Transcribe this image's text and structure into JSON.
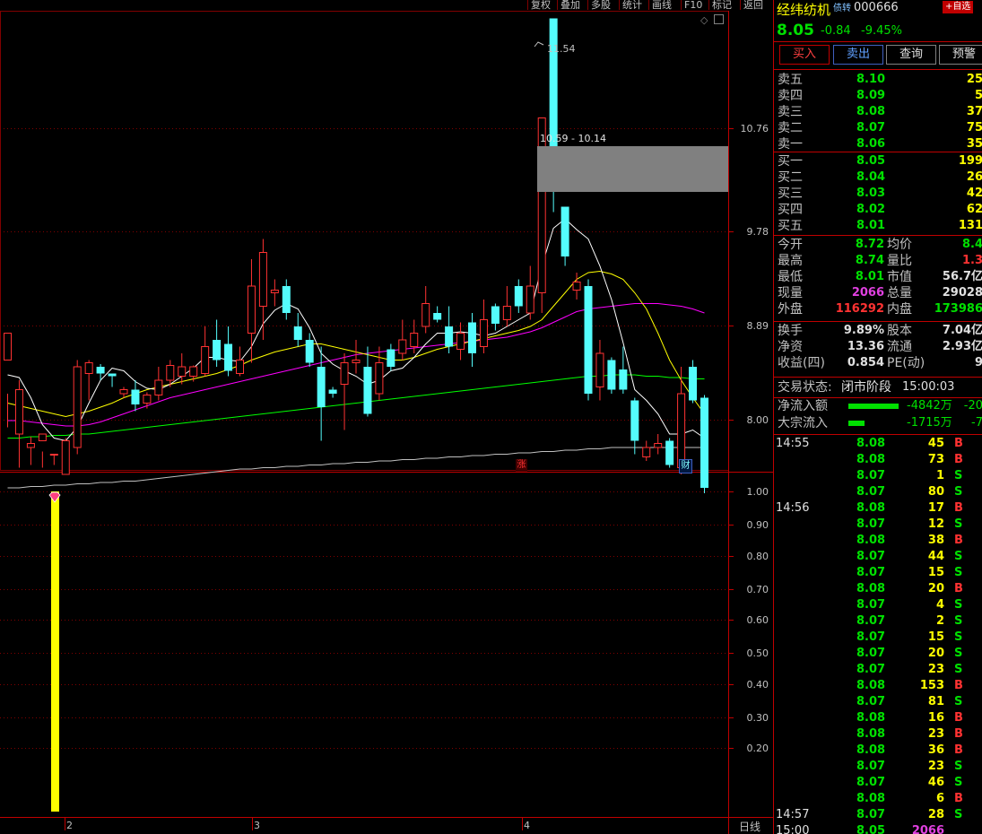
{
  "toolbar": {
    "buttons": [
      "复权",
      "叠加",
      "多股",
      "统计",
      "画线",
      "F10",
      "标记",
      "返回"
    ]
  },
  "chart": {
    "price_axis": [
      "10.76",
      "9.78",
      "8.89",
      "8.00"
    ],
    "peak_label": "11.54",
    "range_label": "10.59 - 10.14",
    "zhang_label": "涨",
    "cai_label": "财",
    "sub_axis": [
      "1.00",
      "0.90",
      "0.80",
      "0.70",
      "0.60",
      "0.50",
      "0.40",
      "0.30",
      "0.20"
    ],
    "date_labels": [
      "2",
      "3",
      "4"
    ],
    "period_label": "日线"
  },
  "chart_data": {
    "type": "candlestick",
    "ohlc": [
      [
        9.0,
        9.2,
        8.75,
        8.5
      ],
      [
        8.45,
        8.78,
        8.85,
        8.2
      ],
      [
        8.35,
        8.38,
        8.43,
        8.22
      ],
      [
        8.4,
        8.45,
        8.32,
        8.2
      ],
      [
        8.3,
        8.3,
        8.3,
        8.22
      ],
      [
        8.15,
        8.4,
        8.42,
        8.15
      ],
      [
        8.35,
        8.95,
        9.0,
        8.3
      ],
      [
        8.9,
        8.98,
        9.0,
        8.7
      ],
      [
        8.95,
        8.9,
        8.97,
        8.85
      ],
      [
        8.9,
        8.88,
        8.9,
        8.8
      ],
      [
        8.75,
        8.78,
        8.8,
        8.72
      ],
      [
        8.78,
        8.67,
        8.85,
        8.62
      ],
      [
        8.68,
        8.74,
        8.76,
        8.64
      ],
      [
        8.74,
        8.85,
        8.95,
        8.7
      ],
      [
        8.85,
        8.96,
        9.0,
        8.8
      ],
      [
        8.88,
        8.95,
        9.05,
        8.82
      ],
      [
        8.88,
        8.95,
        8.96,
        8.84
      ],
      [
        8.9,
        9.1,
        9.25,
        8.88
      ],
      [
        9.15,
        9.0,
        9.3,
        8.95
      ],
      [
        9.12,
        8.92,
        9.25,
        8.88
      ],
      [
        8.9,
        9.0,
        9.1,
        8.88
      ],
      [
        9.2,
        9.55,
        9.75,
        8.98
      ],
      [
        9.4,
        9.8,
        9.9,
        9.15
      ],
      [
        9.5,
        9.52,
        9.6,
        9.4
      ],
      [
        9.55,
        9.35,
        9.6,
        9.3
      ],
      [
        9.25,
        9.15,
        9.35,
        9.1
      ],
      [
        9.15,
        8.98,
        9.2,
        8.95
      ],
      [
        8.95,
        8.65,
        9.1,
        8.4
      ],
      [
        8.78,
        8.75,
        8.8,
        8.72
      ],
      [
        8.82,
        8.98,
        9.05,
        8.48
      ],
      [
        8.98,
        9.0,
        9.15,
        8.9
      ],
      [
        8.95,
        8.6,
        9.1,
        8.58
      ],
      [
        8.75,
        8.98,
        9.1,
        8.7
      ],
      [
        9.08,
        8.95,
        9.12,
        8.92
      ],
      [
        9.05,
        9.15,
        9.3,
        9.0
      ],
      [
        9.1,
        9.2,
        9.3,
        9.05
      ],
      [
        9.25,
        9.42,
        9.55,
        9.2
      ],
      [
        9.35,
        9.3,
        9.4,
        9.28
      ],
      [
        9.25,
        9.1,
        9.4,
        9.05
      ],
      [
        9.08,
        9.2,
        9.28,
        9.0
      ],
      [
        9.28,
        9.05,
        9.35,
        8.95
      ],
      [
        9.1,
        9.3,
        9.45,
        9.05
      ],
      [
        9.4,
        9.27,
        9.42,
        9.22
      ],
      [
        9.3,
        9.4,
        9.55,
        9.25
      ],
      [
        9.55,
        9.4,
        9.6,
        9.35
      ],
      [
        9.35,
        9.55,
        9.7,
        9.3
      ],
      [
        9.5,
        10.8,
        10.8,
        9.35
      ],
      [
        11.54,
        10.59,
        11.54,
        10.1
      ],
      [
        10.14,
        9.77,
        10.14,
        9.7
      ],
      [
        9.52,
        9.58,
        9.65,
        9.45
      ],
      [
        9.55,
        8.75,
        9.6,
        8.7
      ],
      [
        8.8,
        9.05,
        9.15,
        8.7
      ],
      [
        9.0,
        8.78,
        9.02,
        8.75
      ],
      [
        8.93,
        8.78,
        9.1,
        8.75
      ],
      [
        8.7,
        8.4,
        8.72,
        8.3
      ],
      [
        8.28,
        8.35,
        8.4,
        8.25
      ],
      [
        8.35,
        8.38,
        8.45,
        8.3
      ],
      [
        8.4,
        8.22,
        8.42,
        8.2
      ],
      [
        8.2,
        8.75,
        8.95,
        8.15
      ],
      [
        8.95,
        8.7,
        9.0,
        8.68
      ],
      [
        8.72,
        8.05,
        8.74,
        8.01
      ]
    ],
    "ma5": [
      8.89,
      8.87,
      8.72,
      8.52,
      8.42,
      8.4,
      8.5,
      8.68,
      8.85,
      8.94,
      8.92,
      8.84,
      8.79,
      8.78,
      8.82,
      8.88,
      8.94,
      9.02,
      9.02,
      9.0,
      8.99,
      9.1,
      9.27,
      9.37,
      9.42,
      9.38,
      9.24,
      9.05,
      8.97,
      8.92,
      8.88,
      8.82,
      8.85,
      8.92,
      8.94,
      9.02,
      9.12,
      9.2,
      9.2,
      9.21,
      9.2,
      9.18,
      9.2,
      9.25,
      9.3,
      9.35,
      9.7,
      9.98,
      10.05,
      9.97,
      9.9,
      9.7,
      9.45,
      9.13,
      8.78,
      8.7,
      8.6,
      8.45,
      8.45,
      8.48,
      8.42
    ],
    "ma10": [
      8.68,
      8.66,
      8.64,
      8.62,
      8.6,
      8.58,
      8.6,
      8.62,
      8.65,
      8.68,
      8.72,
      8.75,
      8.78,
      8.8,
      8.82,
      8.84,
      8.86,
      8.88,
      8.9,
      8.93,
      8.96,
      9.0,
      9.03,
      9.06,
      9.08,
      9.1,
      9.12,
      9.12,
      9.1,
      9.08,
      9.06,
      9.04,
      9.02,
      9.0,
      9.0,
      9.02,
      9.05,
      9.08,
      9.1,
      9.12,
      9.14,
      9.16,
      9.18,
      9.2,
      9.22,
      9.25,
      9.3,
      9.4,
      9.5,
      9.6,
      9.65,
      9.66,
      9.64,
      9.6,
      9.5,
      9.38,
      9.2,
      9.0,
      8.85,
      8.72,
      8.6
    ],
    "ma20": [
      8.55,
      8.55,
      8.54,
      8.53,
      8.52,
      8.51,
      8.51,
      8.52,
      8.54,
      8.57,
      8.6,
      8.63,
      8.66,
      8.69,
      8.72,
      8.74,
      8.76,
      8.78,
      8.8,
      8.82,
      8.84,
      8.86,
      8.88,
      8.9,
      8.92,
      8.94,
      8.96,
      8.98,
      9.0,
      9.02,
      9.04,
      9.05,
      9.06,
      9.07,
      9.08,
      9.09,
      9.1,
      9.11,
      9.12,
      9.13,
      9.14,
      9.15,
      9.16,
      9.17,
      9.19,
      9.21,
      9.24,
      9.28,
      9.32,
      9.36,
      9.38,
      9.39,
      9.4,
      9.41,
      9.42,
      9.42,
      9.42,
      9.41,
      9.4,
      9.38,
      9.35
    ],
    "ma60": [
      8.42,
      8.42,
      8.43,
      8.43,
      8.44,
      8.44,
      8.45,
      8.45,
      8.46,
      8.47,
      8.48,
      8.49,
      8.5,
      8.51,
      8.52,
      8.53,
      8.54,
      8.55,
      8.56,
      8.57,
      8.58,
      8.59,
      8.6,
      8.61,
      8.62,
      8.63,
      8.64,
      8.65,
      8.66,
      8.67,
      8.68,
      8.69,
      8.7,
      8.71,
      8.72,
      8.73,
      8.74,
      8.75,
      8.76,
      8.77,
      8.78,
      8.79,
      8.8,
      8.81,
      8.82,
      8.83,
      8.84,
      8.85,
      8.86,
      8.87,
      8.88,
      8.88,
      8.89,
      8.89,
      8.89,
      8.88,
      8.88,
      8.87,
      8.87,
      8.86,
      8.86
    ],
    "ma120": [
      8.05,
      8.05,
      8.06,
      8.06,
      8.07,
      8.07,
      8.08,
      8.08,
      8.09,
      8.09,
      8.1,
      8.1,
      8.11,
      8.12,
      8.13,
      8.14,
      8.15,
      8.16,
      8.17,
      8.18,
      8.19,
      8.19,
      8.2,
      8.2,
      8.21,
      8.21,
      8.22,
      8.22,
      8.23,
      8.23,
      8.24,
      8.24,
      8.25,
      8.25,
      8.26,
      8.26,
      8.27,
      8.27,
      8.28,
      8.28,
      8.29,
      8.29,
      8.3,
      8.3,
      8.31,
      8.31,
      8.32,
      8.32,
      8.33,
      8.33,
      8.34,
      8.34,
      8.35,
      8.35,
      8.35,
      8.35,
      8.35,
      8.35,
      8.35,
      8.35,
      8.35
    ],
    "ylim": [
      7.9,
      11.7
    ],
    "indicator": {
      "bar_index": 4,
      "value": 1.0,
      "ylim": [
        0,
        1.0
      ],
      "color": "#ffff00"
    },
    "colors": {
      "up": "#ff3232",
      "down": "#54fcfc",
      "ma5": "#ffffff",
      "ma10": "#ffff00",
      "ma20": "#ff00ff",
      "ma60": "#00ff00",
      "ma120": "#c0c0c0"
    }
  },
  "stock": {
    "name": "经纬纺机",
    "tag": "债转",
    "code": "000666",
    "add_btn": "+自选",
    "price": "8.05",
    "change": "-0.84",
    "change_pct": "-9.45%"
  },
  "actions": [
    "买入",
    "卖出",
    "查询",
    "预警"
  ],
  "asks": [
    {
      "label": "卖五",
      "price": "8.10",
      "vol": "25"
    },
    {
      "label": "卖四",
      "price": "8.09",
      "vol": "5"
    },
    {
      "label": "卖三",
      "price": "8.08",
      "vol": "37"
    },
    {
      "label": "卖二",
      "price": "8.07",
      "vol": "75"
    },
    {
      "label": "卖一",
      "price": "8.06",
      "vol": "35"
    }
  ],
  "bids": [
    {
      "label": "买一",
      "price": "8.05",
      "vol": "199"
    },
    {
      "label": "买二",
      "price": "8.04",
      "vol": "26"
    },
    {
      "label": "买三",
      "price": "8.03",
      "vol": "42"
    },
    {
      "label": "买四",
      "price": "8.02",
      "vol": "62"
    },
    {
      "label": "买五",
      "price": "8.01",
      "vol": "131"
    }
  ],
  "stats": [
    {
      "l1": "今开",
      "v1": "8.72",
      "l2": "均价",
      "v2": "8.4"
    },
    {
      "l1": "最高",
      "v1": "8.74",
      "l2": "量比",
      "v2": "1.3"
    },
    {
      "l1": "最低",
      "v1": "8.01",
      "l2": "市值",
      "v2": "56.7亿"
    },
    {
      "l1": "现量",
      "v1": "2066",
      "l2": "总量",
      "v2": "29028"
    },
    {
      "l1": "外盘",
      "v1": "116292",
      "l2": "内盘",
      "v2": "173986"
    }
  ],
  "stats2": [
    {
      "l1": "换手",
      "v1": "9.89%",
      "l2": "股本",
      "v2": "7.04亿"
    },
    {
      "l1": "净资",
      "v1": "13.36",
      "l2": "流通",
      "v2": "2.93亿"
    },
    {
      "l1": "收益(四)",
      "v1": "0.854",
      "l2": "PE(动)",
      "v2": "9"
    }
  ],
  "trade_state": {
    "label": "交易状态:",
    "state": "闭市阶段",
    "time": "15:00:03"
  },
  "flows": [
    {
      "label": "净流入额",
      "value": "-4842万",
      "extra": "-20"
    },
    {
      "label": "大宗流入",
      "value": "-1715万",
      "extra": "-7"
    }
  ],
  "ticks": [
    {
      "time": "14:55",
      "price": "8.08",
      "vol": "45",
      "bs": "B"
    },
    {
      "time": "",
      "price": "8.08",
      "vol": "73",
      "bs": "B"
    },
    {
      "time": "",
      "price": "8.07",
      "vol": "1",
      "bs": "S"
    },
    {
      "time": "",
      "price": "8.07",
      "vol": "80",
      "bs": "S"
    },
    {
      "time": "14:56",
      "price": "8.08",
      "vol": "17",
      "bs": "B"
    },
    {
      "time": "",
      "price": "8.07",
      "vol": "12",
      "bs": "S"
    },
    {
      "time": "",
      "price": "8.08",
      "vol": "38",
      "bs": "B"
    },
    {
      "time": "",
      "price": "8.07",
      "vol": "44",
      "bs": "S"
    },
    {
      "time": "",
      "price": "8.07",
      "vol": "15",
      "bs": "S"
    },
    {
      "time": "",
      "price": "8.08",
      "vol": "20",
      "bs": "B"
    },
    {
      "time": "",
      "price": "8.07",
      "vol": "4",
      "bs": "S"
    },
    {
      "time": "",
      "price": "8.07",
      "vol": "2",
      "bs": "S"
    },
    {
      "time": "",
      "price": "8.07",
      "vol": "15",
      "bs": "S"
    },
    {
      "time": "",
      "price": "8.07",
      "vol": "20",
      "bs": "S"
    },
    {
      "time": "",
      "price": "8.07",
      "vol": "23",
      "bs": "S"
    },
    {
      "time": "",
      "price": "8.08",
      "vol": "153",
      "bs": "B"
    },
    {
      "time": "",
      "price": "8.07",
      "vol": "81",
      "bs": "S"
    },
    {
      "time": "",
      "price": "8.08",
      "vol": "16",
      "bs": "B"
    },
    {
      "time": "",
      "price": "8.08",
      "vol": "23",
      "bs": "B"
    },
    {
      "time": "",
      "price": "8.08",
      "vol": "36",
      "bs": "B"
    },
    {
      "time": "",
      "price": "8.07",
      "vol": "23",
      "bs": "S"
    },
    {
      "time": "",
      "price": "8.07",
      "vol": "46",
      "bs": "S"
    },
    {
      "time": "",
      "price": "8.08",
      "vol": "6",
      "bs": "B"
    },
    {
      "time": "14:57",
      "price": "8.07",
      "vol": "28",
      "bs": "S"
    },
    {
      "time": "15:00",
      "price": "8.05",
      "vol": "2066",
      "bs": ""
    }
  ]
}
